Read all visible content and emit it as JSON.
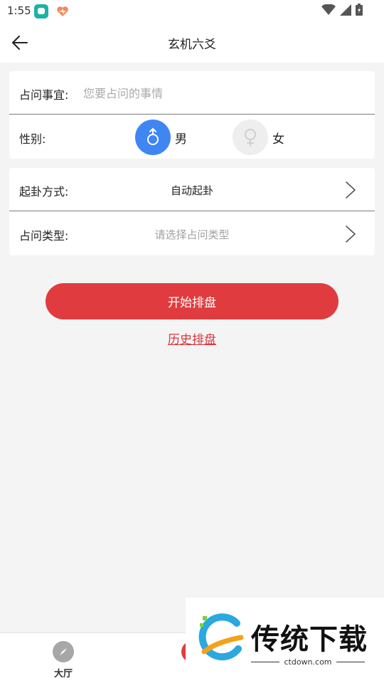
{
  "status_bar": {
    "time": "1:55",
    "icons": [
      "app-icon",
      "app-icon",
      "wifi-icon",
      "signal-icon",
      "battery-icon"
    ]
  },
  "header": {
    "title": "玄机六爻",
    "back_icon": "arrow-left-icon"
  },
  "form": {
    "question": {
      "label": "占问事宜:",
      "placeholder": "您要占问的事情",
      "value": ""
    },
    "gender": {
      "label": "性别:",
      "options": [
        {
          "label": "男",
          "icon": "male-icon",
          "selected": true
        },
        {
          "label": "女",
          "icon": "female-icon",
          "selected": false
        }
      ]
    },
    "method": {
      "label": "起卦方式:",
      "value": "自动起卦"
    },
    "type": {
      "label": "占问类型:",
      "placeholder": "请选择占问类型"
    }
  },
  "actions": {
    "start_label": "开始排盘",
    "history_label": "历史排盘"
  },
  "bottom_nav": {
    "items": [
      {
        "label": "大厅",
        "icon": "compass-icon"
      },
      {
        "label": "",
        "icon": "app-icon"
      }
    ]
  },
  "watermark": {
    "text": "传统下载",
    "url": "ctdown.com"
  },
  "colors": {
    "accent_red": "#e03c3f",
    "male_blue": "#3f86f3",
    "background": "#f4f4f4"
  }
}
